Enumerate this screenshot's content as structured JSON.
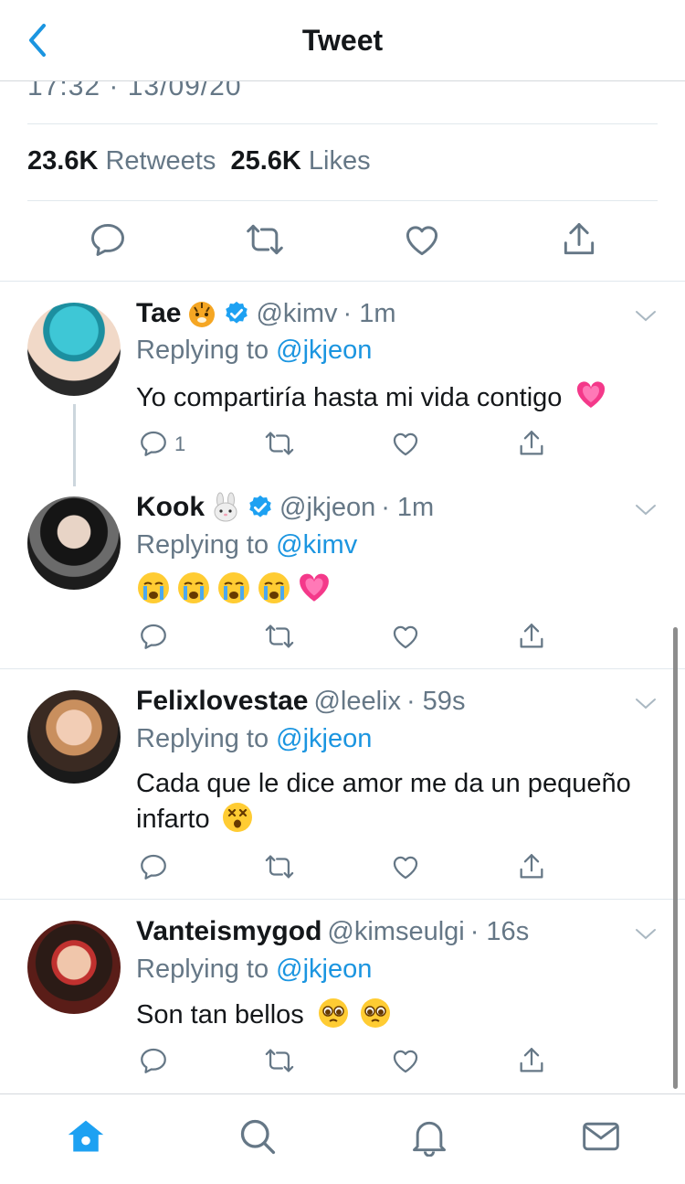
{
  "header": {
    "title": "Tweet"
  },
  "tweet": {
    "timestamp": "17:32 · 13/09/20",
    "retweets_count": "23.6K",
    "retweets_label": "Retweets",
    "likes_count": "25.6K",
    "likes_label": "Likes"
  },
  "replies": [
    {
      "name": "Tae",
      "handle": "@kimv",
      "time": "· 1m",
      "replying_prefix": "Replying to",
      "replying_to": "@jkjeon",
      "text": "Yo compartiría hasta mi vida contigo",
      "reply_count": "1"
    },
    {
      "name": "Kook",
      "handle": "@jkjeon",
      "time": "· 1m",
      "replying_prefix": "Replying to",
      "replying_to": "@kimv",
      "text": ""
    },
    {
      "name": "Felixlovestae",
      "handle": "@leelix",
      "time": "· 59s",
      "replying_prefix": "Replying to",
      "replying_to": "@jkjeon",
      "text": "Cada que le dice amor me da un pequeño infarto"
    },
    {
      "name": "Vanteismygod",
      "handle": "@kimseulgi",
      "time": "· 16s",
      "replying_prefix": "Replying to",
      "replying_to": "@jkjeon",
      "text": "Son tan bellos"
    }
  ],
  "colors": {
    "accent": "#1b95e0",
    "muted": "#657786",
    "verified": "#1da1f2"
  },
  "tabs": [
    "home-icon",
    "search-icon",
    "notifications-icon",
    "messages-icon"
  ]
}
